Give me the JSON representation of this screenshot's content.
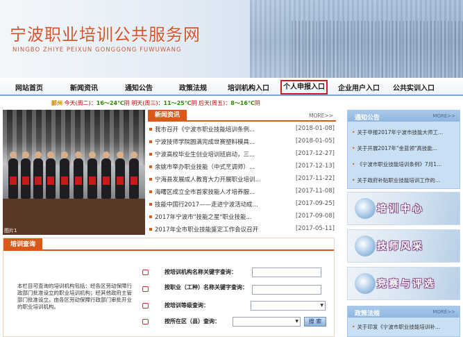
{
  "header": {
    "title": "宁波职业培训公共服务网",
    "subtitle": "NINGBO ZHIYE PEIXUN GONGGONG FUWUWANG"
  },
  "nav": {
    "items": [
      {
        "label": "网站首页",
        "active": false
      },
      {
        "label": "新闻资讯",
        "active": false
      },
      {
        "label": "通知公告",
        "active": false
      },
      {
        "label": "政策法规",
        "active": false
      },
      {
        "label": "培训机构入口",
        "active": false
      },
      {
        "label": "个人申报入口",
        "active": true
      },
      {
        "label": "企业用户入口",
        "active": false
      },
      {
        "label": "公共实训入口",
        "active": false
      }
    ]
  },
  "weather": {
    "city": "鄞州",
    "today_label": "今天(周二)：",
    "today_temp": "16～24℃",
    "today_cond": "阴",
    "tomorrow_label": "明天(周三)：",
    "tomorrow_temp": "11～25℃",
    "tomorrow_cond": "阴",
    "after_label": "后天(周五)：",
    "after_temp": "8～16℃",
    "after_cond": "阴"
  },
  "photo": {
    "caption": "图片1"
  },
  "news": {
    "title": "新闻资讯",
    "more": "MORE>>",
    "items": [
      {
        "title": "我市召开《宁波市职业技能培训条例...",
        "date": "[2018-01-08]"
      },
      {
        "title": "宁波技师学院圆满完成世赛塑料模具...",
        "date": "[2018-01-05]"
      },
      {
        "title": "宁波高校毕业生创业培训班启动，三...",
        "date": "[2017-12-27]"
      },
      {
        "title": "余姚市举办职业技能（中式烹调师）...",
        "date": "[2017-12-13]"
      },
      {
        "title": "宁海县发展成人教育大力开展职业培训...",
        "date": "[2017-11-22]"
      },
      {
        "title": "海曙区成立全市首家技能人才培养服...",
        "date": "[2017-11-08]"
      },
      {
        "title": "技能中国行2017——走进宁波活动成...",
        "date": "[2017-09-25]"
      },
      {
        "title": "2017年宁波市\"技能之星\"职业技能...",
        "date": "[2017-09-08]"
      },
      {
        "title": "2017年全市职业技能鉴定工作会议召开",
        "date": "[2017-05-11]"
      }
    ]
  },
  "notice": {
    "title": "通知公告",
    "more": "MORE>>",
    "items": [
      "关于申报2017年宁波市技能大师工...",
      "关于开展2017年\"金蓝领\"高技能...",
      "《宁波市职业技能培训条例》7月1...",
      "关于政府补贴职业技能培训工作的..."
    ]
  },
  "promos": [
    {
      "label": "培训中心"
    },
    {
      "label": "技师风采"
    },
    {
      "label": "竞赛与评选"
    }
  ],
  "laws": {
    "title": "政策法规",
    "more": "MORE>>",
    "items": [
      "关于印发《宁波市职业技能培训补..."
    ]
  },
  "query": {
    "title": "培训查询",
    "description": "本栏目可查询的培训机构包括：经各区劳动保障行政部门批准设立的职业培训机构；经其他政府主管部门批准设立，由各区劳动保障行政部门审批开业的职业培训机构。",
    "rows": [
      {
        "label": "按培训机构名称关键字查询："
      },
      {
        "label": "按职业（工种）名称关键字查询："
      },
      {
        "label": "按培训等级查询："
      },
      {
        "label": "按所在区（县）查询："
      }
    ],
    "search_button": "搜 索"
  },
  "colors": {
    "accent_orange": "#d85a1a",
    "title_red": "#d9532c",
    "active_border": "#d41a1a",
    "side_blue": "#c9dff3"
  }
}
